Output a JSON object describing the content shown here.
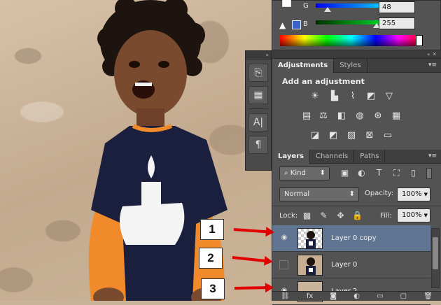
{
  "colors": {
    "accent": "#5f7591",
    "panel": "#535353",
    "arrow": "#e10000"
  },
  "color_panel": {
    "g_label": "G",
    "g_value": "48",
    "b_label": "B",
    "b_value": "255"
  },
  "adjustments": {
    "tabs": [
      {
        "label": "Adjustments"
      },
      {
        "label": "Styles"
      }
    ],
    "title": "Add an adjustment"
  },
  "layers": {
    "tabs": [
      {
        "label": "Layers"
      },
      {
        "label": "Channels"
      },
      {
        "label": "Paths"
      }
    ],
    "filter_kind": "Kind",
    "blend_mode": "Normal",
    "opacity_label": "Opacity:",
    "opacity_value": "100%",
    "lock_label": "Lock:",
    "fill_label": "Fill:",
    "fill_value": "100%",
    "items": [
      {
        "name": "Layer 0 copy",
        "visible": true,
        "selected": true
      },
      {
        "name": "Layer 0",
        "visible": false,
        "selected": false
      },
      {
        "name": "Layer 2",
        "visible": true,
        "selected": false
      }
    ]
  },
  "callouts": [
    "1",
    "2",
    "3"
  ]
}
